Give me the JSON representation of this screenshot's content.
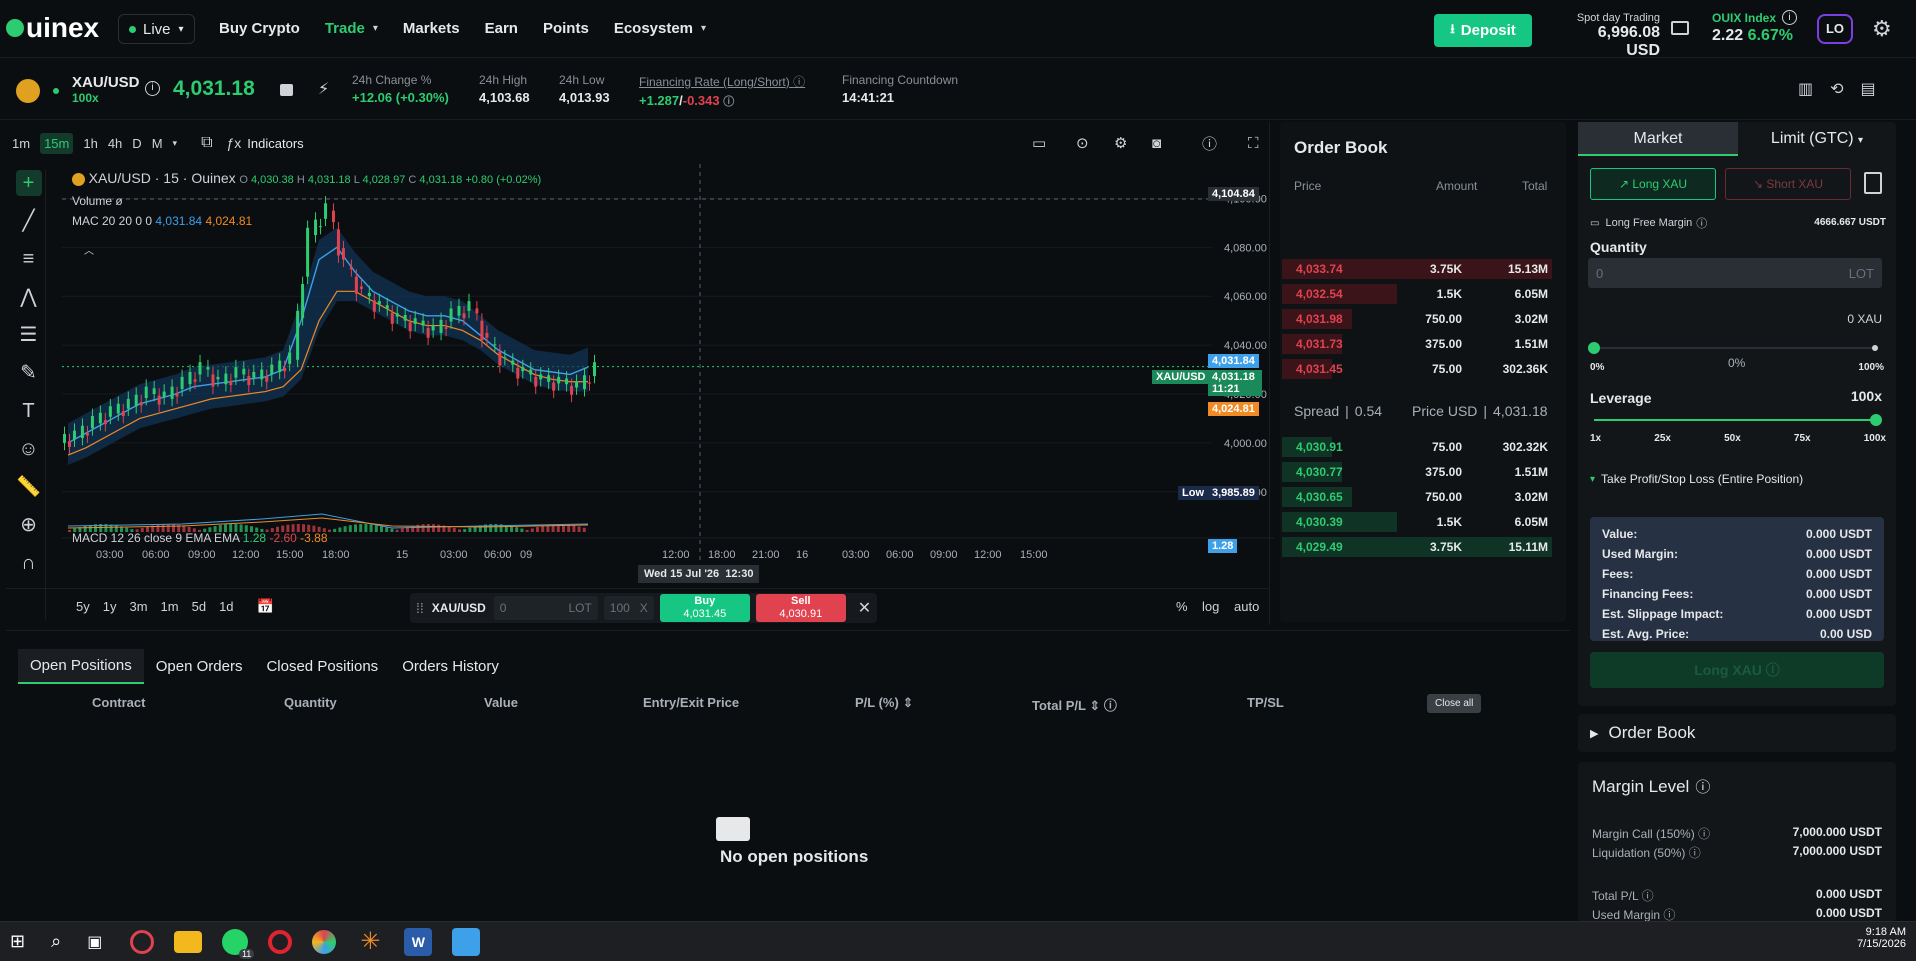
{
  "header": {
    "logo": "uinex",
    "env_label": "Live",
    "nav": [
      "Buy Crypto",
      "Trade",
      "Markets",
      "Earn",
      "Points",
      "Ecosystem"
    ],
    "deposit_label": "Deposit",
    "balance_label": "Spot day Trading",
    "balance_value": "6,996.08 USD",
    "index_label": "OUIX Index",
    "index_value": "2.22",
    "index_change": "6.67%",
    "avatar": "LO"
  },
  "ticker": {
    "symbol": "XAU/USD",
    "leverage": "100x",
    "price": "4,031.18",
    "change_label": "24h Change %",
    "change_value": "+12.06 (+0.30%)",
    "high_label": "24h High",
    "high_value": "4,103.68",
    "low_label": "24h Low",
    "low_value": "4,013.93",
    "fin_label": "Financing Rate (Long/Short)",
    "fin_long": "+1.287",
    "fin_sep": "/",
    "fin_short": "-0.343",
    "countdown_label": "Financing Countdown",
    "countdown_value": "14:41:21"
  },
  "chart_toolbar": {
    "timeframes": [
      "1m",
      "15m",
      "1h",
      "4h",
      "D",
      "M"
    ],
    "indicators_label": "Indicators"
  },
  "chart_data": {
    "type": "line",
    "title": "XAU/USD · 15 · Ouinex",
    "ohlc": {
      "o": "O",
      "o_v": "4,030.38",
      "h": "H",
      "h_v": "4,031.18",
      "l": "L",
      "l_v": "4,028.97",
      "c": "C",
      "c_v": "4,031.18",
      "chg": "+0.80 (+0.02%)"
    },
    "volume_label": "Volume",
    "volume_value": "ø",
    "mac_label": "MAC 20 20 0 0",
    "mac_v1": "4,031.84",
    "mac_v2": "4,024.81",
    "macd_label": "MACD 12 26 close 9 EMA EMA",
    "macd_v1": "1.28",
    "macd_v2": "-2.60",
    "macd_v3": "-3.88",
    "y_ticks": [
      "4,100.00",
      "4,080.00",
      "4,060.00",
      "4,040.00",
      "4,020.00",
      "4,000.00",
      "3,980.00"
    ],
    "x_ticks": [
      "03:00",
      "06:00",
      "09:00",
      "12:00",
      "15:00",
      "18:00",
      "15",
      "03:00",
      "06:00",
      "09",
      "12:00",
      "18:00",
      "21:00",
      "16",
      "03:00",
      "06:00",
      "09:00",
      "12:00",
      "15:00"
    ],
    "crosshair_date": "Wed 15 Jul '26",
    "crosshair_time": "12:30",
    "tags": {
      "top": "4,104.84",
      "mac1": "4,031.84",
      "sym": "XAU/USD",
      "price": "4,031.18",
      "timer": "11:21",
      "mac2": "4,024.81",
      "low_label": "Low",
      "low": "3,985.89",
      "macd": "1.28"
    },
    "series": [
      {
        "values": [
          4002,
          4008,
          4012,
          4015,
          4020,
          4018,
          4024,
          4030,
          4024,
          4028,
          4026,
          4029,
          4034,
          4085,
          4095,
          4072,
          4060,
          4055,
          4050,
          4048,
          4045,
          4052,
          4055,
          4040,
          4032,
          4028,
          4025,
          4024,
          4022,
          4030
        ]
      },
      {
        "values": [
          4000,
          4004,
          4008,
          4012,
          4016,
          4018,
          4020,
          4023,
          4024,
          4025,
          4026,
          4027,
          4030,
          4050,
          4075,
          4080,
          4070,
          4062,
          4058,
          4054,
          4052,
          4052,
          4050,
          4044,
          4038,
          4034,
          4030,
          4029,
          4028,
          4031
        ]
      },
      {
        "values": [
          3995,
          3998,
          4002,
          4006,
          4010,
          4012,
          4014,
          4016,
          4018,
          4019,
          4020,
          4021,
          4023,
          4030,
          4050,
          4062,
          4062,
          4058,
          4054,
          4050,
          4048,
          4048,
          4046,
          4042,
          4036,
          4032,
          4028,
          4026,
          4025,
          4025
        ]
      }
    ],
    "ylim": [
      3975,
      4110
    ]
  },
  "range_bar": {
    "ranges": [
      "5y",
      "1y",
      "3m",
      "1m",
      "5d",
      "1d"
    ],
    "symbol": "XAU/USD",
    "qty_placeholder": "0",
    "unit": "LOT",
    "qty2": "100",
    "x": "X",
    "buy_label": "Buy",
    "buy_price": "4,031.45",
    "sell_label": "Sell",
    "sell_price": "4,030.91",
    "pct": "%",
    "log": "log",
    "auto": "auto"
  },
  "orderbook": {
    "title": "Order Book",
    "cols": [
      "Price",
      "Amount",
      "Total"
    ],
    "asks": [
      {
        "price": "4,033.74",
        "amount": "3.75K",
        "total": "15.13M"
      },
      {
        "price": "4,032.54",
        "amount": "1.5K",
        "total": "6.05M"
      },
      {
        "price": "4,031.98",
        "amount": "750.00",
        "total": "3.02M"
      },
      {
        "price": "4,031.73",
        "amount": "375.00",
        "total": "1.51M"
      },
      {
        "price": "4,031.45",
        "amount": "75.00",
        "total": "302.36K"
      }
    ],
    "spread_label": "Spread",
    "spread_value": "0.54",
    "price_label": "Price USD",
    "price_value": "4,031.18",
    "bids": [
      {
        "price": "4,030.91",
        "amount": "75.00",
        "total": "302.32K"
      },
      {
        "price": "4,030.77",
        "amount": "375.00",
        "total": "1.51M"
      },
      {
        "price": "4,030.65",
        "amount": "750.00",
        "total": "3.02M"
      },
      {
        "price": "4,030.39",
        "amount": "1.5K",
        "total": "6.05M"
      },
      {
        "price": "4,029.49",
        "amount": "3.75K",
        "total": "15.11M"
      }
    ]
  },
  "order_form": {
    "tab_market": "Market",
    "tab_limit": "Limit (GTC)",
    "long_label": "Long  XAU",
    "short_label": "Short  XAU",
    "free_margin_label": "Long Free Margin",
    "free_margin_value": "4666.667 USDT",
    "qty_label": "Quantity",
    "qty_placeholder": "0",
    "qty_unit": "LOT",
    "qty_xau": "0 XAU",
    "slider_min": "0%",
    "slider_mid": "0%",
    "slider_max": "100%",
    "qty_fill": 0,
    "leverage_label": "Leverage",
    "leverage_value": "100x",
    "lev_ticks": [
      "1x",
      "25x",
      "50x",
      "75x",
      "100x"
    ],
    "lev_fill": 1.0,
    "tpsl_label": "Take Profit/Stop Loss (Entire Position)",
    "summary": [
      {
        "k": "Value:",
        "v": "0.000 USDT"
      },
      {
        "k": "Used Margin:",
        "v": "0.000 USDT"
      },
      {
        "k": "Fees:",
        "v": "0.000 USDT"
      },
      {
        "k": "Financing Fees:",
        "v": "0.000 USDT"
      },
      {
        "k": "Est. Slippage Impact:",
        "v": "0.000 USDT"
      },
      {
        "k": "Est. Avg. Price:",
        "v": "0.00 USD"
      }
    ],
    "submit_label": "Long XAU",
    "orderbook_label": "Order Book",
    "margin_title": "Margin Level",
    "margin_call_label": "Margin Call",
    "margin_call_pct": "(150%)",
    "margin_call_value": "7,000.000 USDT",
    "liq_label": "Liquidation",
    "liq_pct": "(50%)",
    "liq_value": "7,000.000 USDT",
    "total_pl_label": "Total P/L",
    "total_pl_value": "0.000 USDT",
    "used_margin_label": "Used Margin",
    "used_margin_value": "0.000 USDT"
  },
  "positions": {
    "tabs": [
      "Open Positions",
      "Open Orders",
      "Closed Positions",
      "Orders History"
    ],
    "cols": [
      "Contract",
      "Quantity",
      "Value",
      "Entry/Exit Price",
      "P/L (%)",
      "Total P/L",
      "TP/SL"
    ],
    "close_all": "Close all",
    "empty": "No open positions"
  },
  "taskbar": {
    "time": "9:18 AM",
    "date": "7/15/2026",
    "badge": "11"
  }
}
